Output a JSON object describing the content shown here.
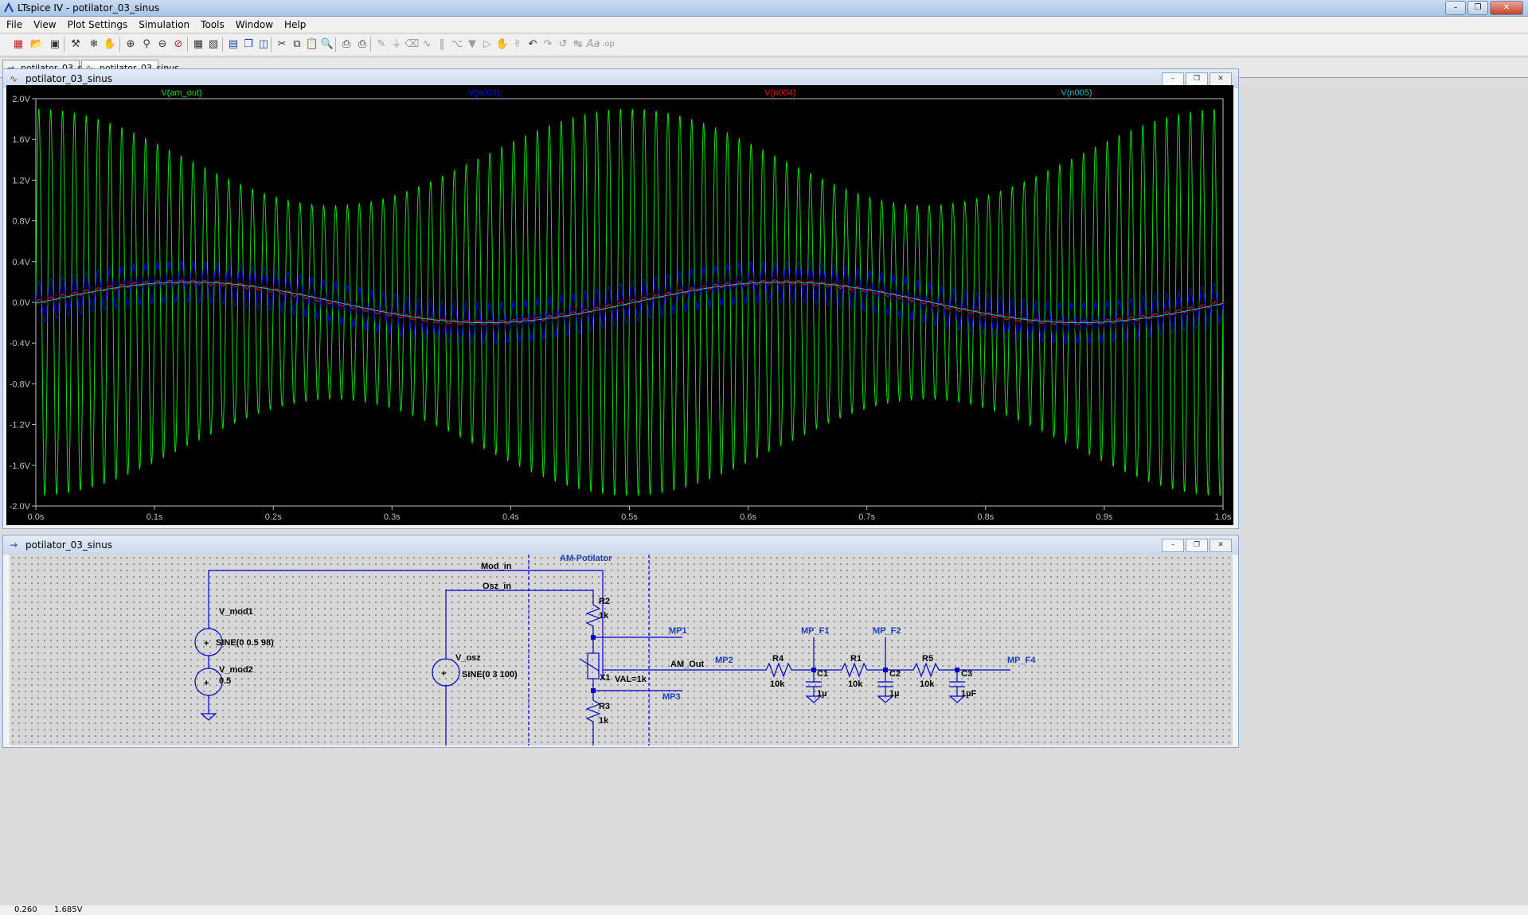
{
  "app": {
    "title": "LTspice IV - potilator_03_sinus",
    "window_buttons": [
      "–",
      "❐",
      "✕"
    ]
  },
  "menu": [
    "File",
    "View",
    "Plot Settings",
    "Simulation",
    "Tools",
    "Window",
    "Help"
  ],
  "toolbar": {
    "icons": [
      "new-schematic-icon",
      "open-icon",
      "save-icon",
      "control-panel-icon",
      "run-icon",
      "halt-icon",
      "zoom-in-icon",
      "zoom-area-icon",
      "zoom-out-icon",
      "zoom-fit-icon",
      "autorange-icon",
      "cursor-icon",
      "tile-horizontal-icon",
      "cascade-icon",
      "tile-vertical-icon",
      "cut-icon",
      "copy-icon",
      "paste-icon",
      "find-icon",
      "print-setup-icon",
      "print-icon",
      "draw-wire-icon",
      "ground-icon",
      "label-net-icon",
      "resistor-icon",
      "capacitor-icon",
      "inductor-icon",
      "diode-icon",
      "component-icon",
      "move-icon",
      "drag-icon",
      "undo-icon",
      "redo-icon",
      "rotate-icon",
      "mirror-icon",
      "text-icon",
      "spice-directive-icon"
    ]
  },
  "tabs": [
    {
      "label": "potilator_03_sinus",
      "kind": "schematic",
      "active": false
    },
    {
      "label": "potilator_03_sinus",
      "kind": "waveform",
      "active": true
    }
  ],
  "waveform_window": {
    "title": "potilator_03_sinus",
    "buttons": [
      "–",
      "❐",
      "✕"
    ]
  },
  "schematic_window": {
    "title": "potilator_03_sinus",
    "buttons": [
      "–",
      "❐",
      "✕"
    ]
  },
  "chart_data": {
    "type": "line",
    "background": "#000000",
    "xlim": [
      0.0,
      1.0
    ],
    "ylim": [
      -2.0,
      2.0
    ],
    "x_ticks": [
      "0.0s",
      "0.1s",
      "0.2s",
      "0.3s",
      "0.4s",
      "0.5s",
      "0.6s",
      "0.7s",
      "0.8s",
      "0.9s",
      "1.0s"
    ],
    "y_ticks": [
      "2.0V",
      "1.6V",
      "1.2V",
      "0.8V",
      "0.4V",
      "0.0V",
      "-0.4V",
      "-0.8V",
      "-1.2V",
      "-1.6V",
      "-2.0V"
    ],
    "series": [
      {
        "name": "V(am_out)",
        "color": "#00e000",
        "carrier_hz": 100,
        "carrier_amplitude": 0.3,
        "modulation_hz": 2,
        "envelope_min_peak": 0.95,
        "envelope_max_peak": 1.9,
        "envelope_max_at_s": [
          0.0,
          0.5,
          1.0
        ],
        "envelope_min_at_s": [
          0.25,
          0.75
        ]
      },
      {
        "name": "V(n003)",
        "color": "#0000ff",
        "carrier_hz": 100,
        "offset_amplitude": 0.2,
        "ripple_amplitude": 0.2
      },
      {
        "name": "V(n004)",
        "color": "#ff0000",
        "offset_amplitude": 0.2,
        "ripple_amplitude": 0.02
      },
      {
        "name": "V(n005)",
        "color": "#00c0c0",
        "amplitude": 0.2,
        "modulation_hz": 2
      }
    ]
  },
  "schematic": {
    "labels": {
      "block_title": "AM-Potilator",
      "mod_in": "Mod_in",
      "osz_in": "Osz_in",
      "am_out": "AM_Out",
      "mp1": "MP1",
      "mp2": "MP2",
      "mp3": "MP3",
      "mp_f1": "MP_F1",
      "mp_f2": "MP_F2",
      "mp_f4": "MP_F4"
    },
    "sources": [
      {
        "name": "V_mod1",
        "value": "SINE(0 0.5 98)"
      },
      {
        "name": "V_mod2",
        "value": "0.5"
      },
      {
        "name": "V_osz",
        "value": "SINE(0 3 100)"
      }
    ],
    "resistors": [
      {
        "name": "R2",
        "value": "1k"
      },
      {
        "name": "R3",
        "value": "1k"
      },
      {
        "name": "R4",
        "value": "10k"
      },
      {
        "name": "R1",
        "value": "10k"
      },
      {
        "name": "R5",
        "value": "10k"
      }
    ],
    "capacitors": [
      {
        "name": "C1",
        "value": "1µ"
      },
      {
        "name": "C2",
        "value": "1µ"
      },
      {
        "name": "C3",
        "value": "1µF"
      }
    ],
    "potentiometer": {
      "name": "X1",
      "value": "VAL=1k"
    }
  },
  "status": {
    "left": "0.260",
    "right": "1.685V"
  },
  "colors": {
    "wire": "#0000d0",
    "text": "#000000",
    "net_label": "#1a3fc0",
    "grid_dot": "#7a7a7a"
  }
}
